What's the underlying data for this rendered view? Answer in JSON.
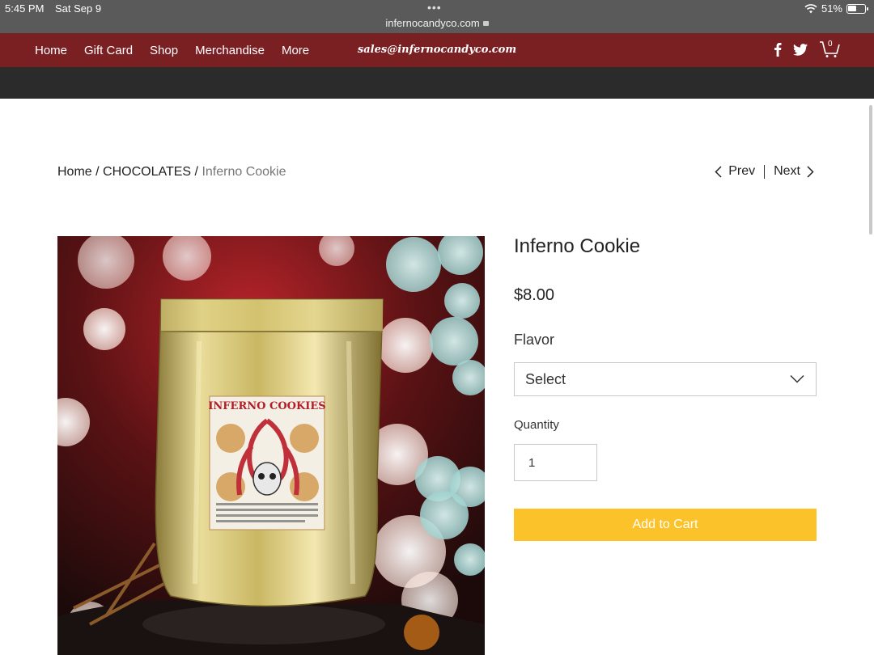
{
  "status_bar": {
    "time": "5:45 PM",
    "date": "Sat Sep 9",
    "dots": "•••",
    "url": "infernocandyco.com",
    "battery": "51%",
    "battery_level": 0.51
  },
  "header": {
    "nav": [
      "Home",
      "Gift Card",
      "Shop",
      "Merchandise",
      "More"
    ],
    "email": "sales@infernocandyco.com",
    "cart_count": "0",
    "brand_color": "#7a1f22"
  },
  "breadcrumb": {
    "home": "Home",
    "separator": " / ",
    "category": "CHOCOLATES",
    "current": "Inferno Cookie"
  },
  "pager": {
    "prev": "Prev",
    "next": "Next"
  },
  "product": {
    "title": "Inferno Cookie",
    "price": "$8.00",
    "flavor_label": "Flavor",
    "flavor_value": "Select",
    "quantity_label": "Quantity",
    "quantity_value": "1",
    "add_to_cart": "Add to Cart",
    "button_color": "#fcc22a",
    "image_label": "INFERNO COOKIES"
  }
}
